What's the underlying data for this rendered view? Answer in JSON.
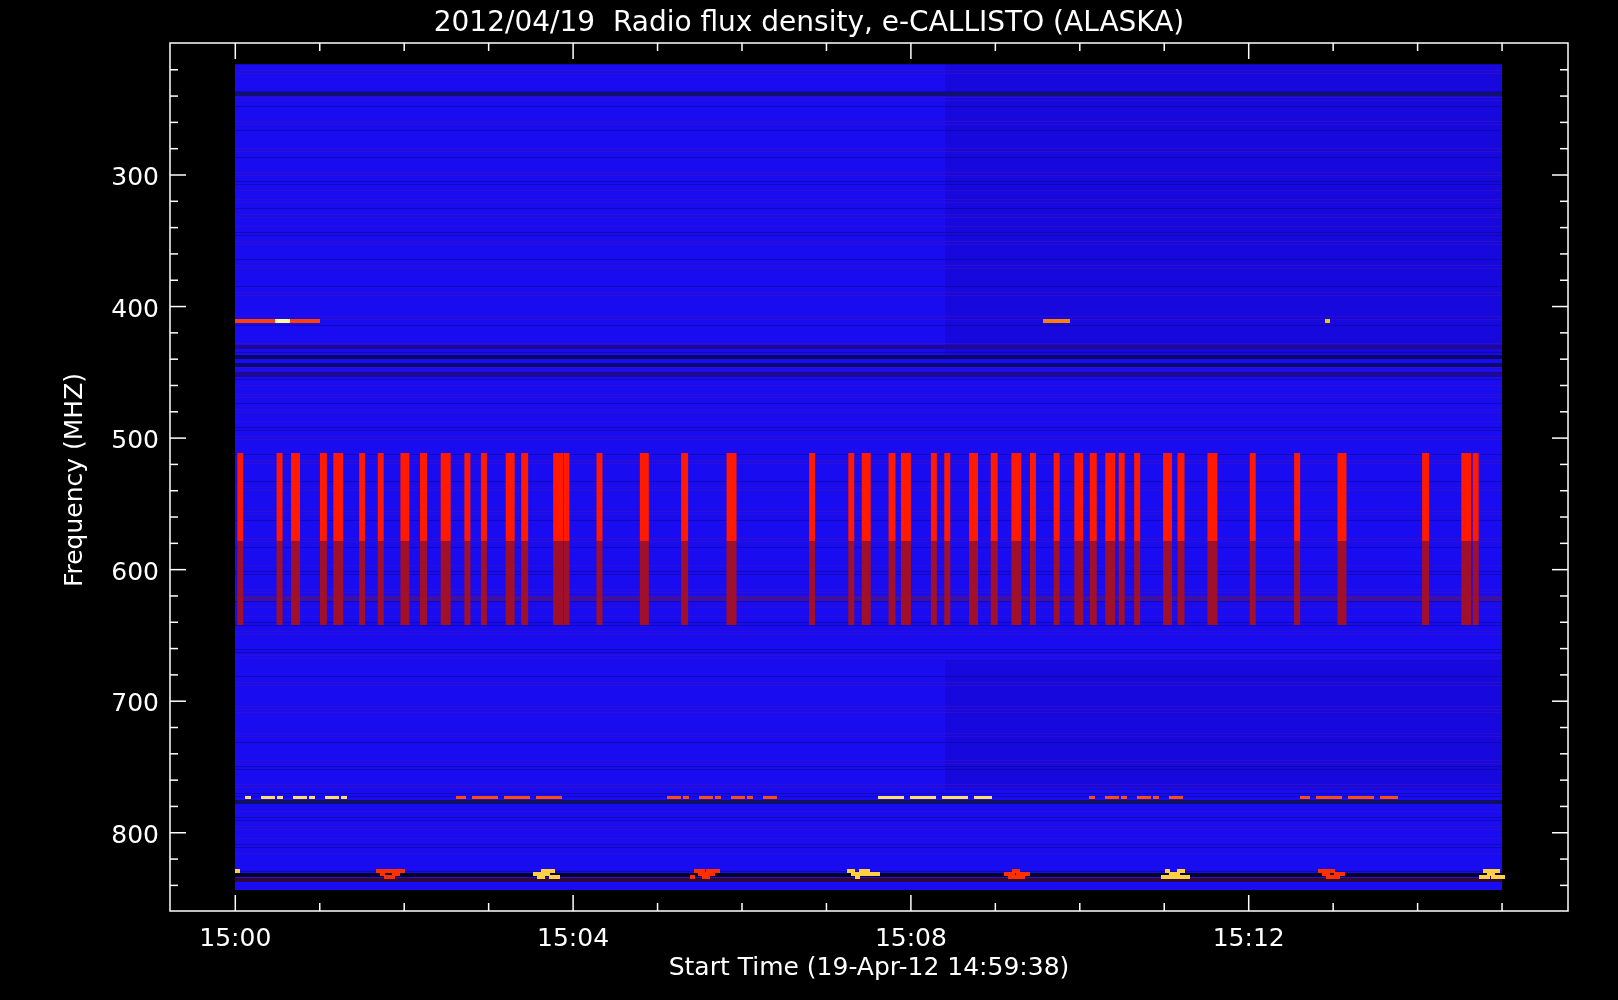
{
  "title": "2012/04/19  Radio flux density, e-CALLISTO (ALASKA)",
  "y_axis": {
    "label": "Frequency (MHZ)",
    "ticks": [
      "300",
      "400",
      "500",
      "600",
      "700",
      "800"
    ]
  },
  "x_axis": {
    "label": "Start Time (19-Apr-12 14:59:38)",
    "ticks": [
      "15:00",
      "15:04",
      "15:08",
      "15:12"
    ]
  }
}
